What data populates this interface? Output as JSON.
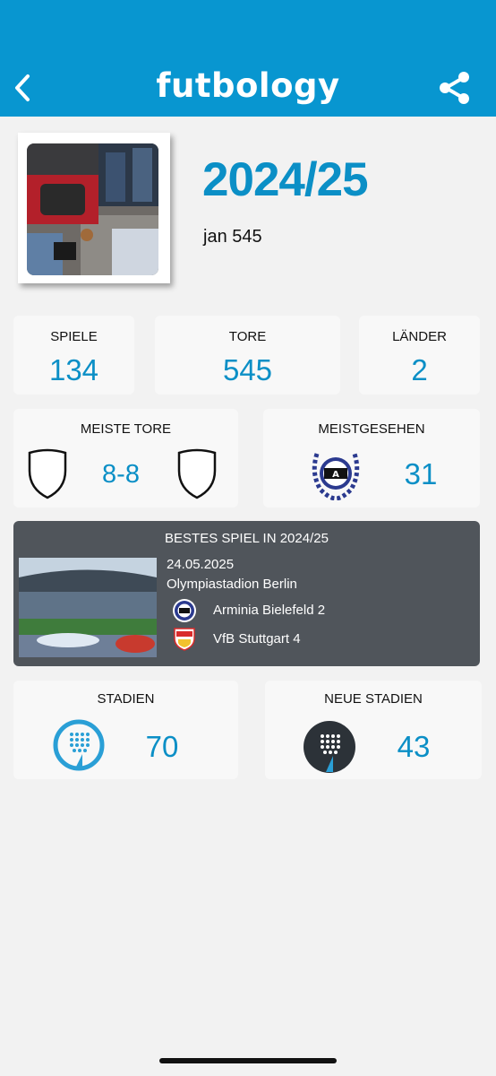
{
  "header": {
    "logo": "futbology",
    "back_icon": "chevron-left-icon",
    "share_icon": "share-icon"
  },
  "profile": {
    "season": "2024/25",
    "username": "jan 545"
  },
  "stats": {
    "games": {
      "label": "SPIELE",
      "value": "134"
    },
    "goals": {
      "label": "TORE",
      "value": "545"
    },
    "countries": {
      "label": "LÄNDER",
      "value": "2"
    }
  },
  "most_goals": {
    "label": "MEISTE TORE",
    "score": "8-8"
  },
  "most_seen": {
    "label": "MEISTGESEHEN",
    "value": "31"
  },
  "best_match": {
    "title": "BESTES SPIEL IN 2024/25",
    "date": "24.05.2025",
    "venue": "Olympiastadion Berlin",
    "home": "Arminia Bielefeld 2",
    "away": "VfB Stuttgart 4"
  },
  "stadiums": {
    "label": "STADIEN",
    "value": "70"
  },
  "new_stadiums": {
    "label": "NEUE STADIEN",
    "value": "43"
  },
  "colors": {
    "brand": "#0896d0",
    "value_blue": "#0b8fc6",
    "dark_card": "#50555b"
  }
}
